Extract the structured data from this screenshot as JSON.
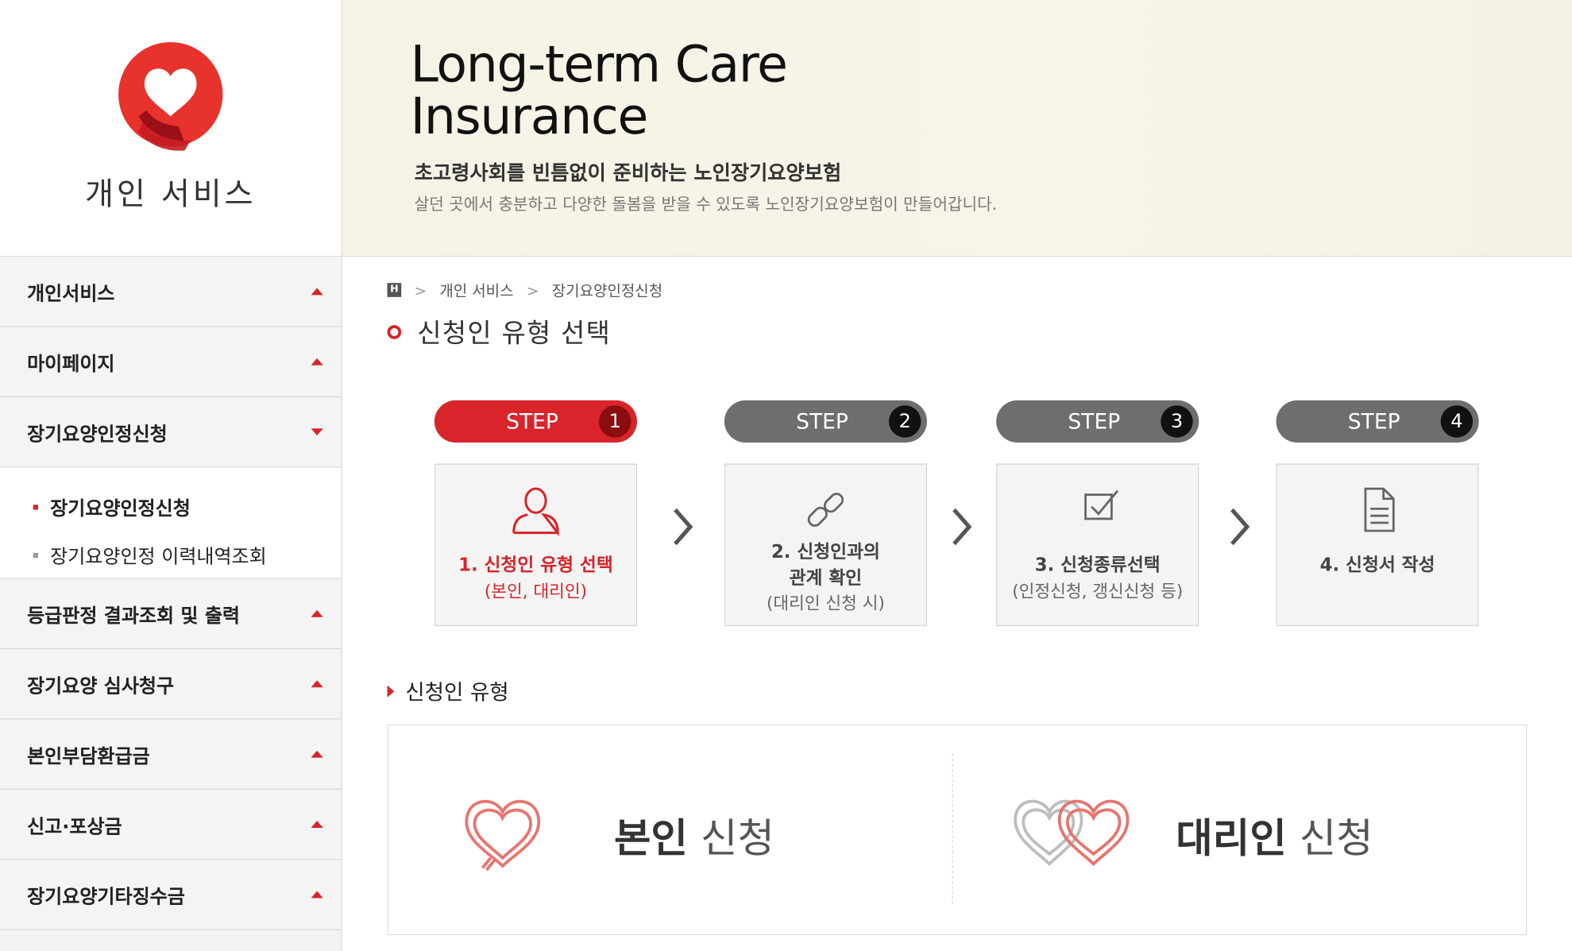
{
  "brand": {
    "section_title": "개인 서비스"
  },
  "sidebar": {
    "items": [
      {
        "label": "개인서비스",
        "state": "collapsed"
      },
      {
        "label": "마이페이지",
        "state": "collapsed"
      },
      {
        "label": "장기요양인정신청",
        "state": "expanded"
      },
      {
        "label": "등급판정 결과조회 및 출력",
        "state": "collapsed"
      },
      {
        "label": "장기요양 심사청구",
        "state": "collapsed"
      },
      {
        "label": "본인부담환급금",
        "state": "collapsed"
      },
      {
        "label": "신고·포상금",
        "state": "collapsed"
      },
      {
        "label": "장기요양기타징수금",
        "state": "collapsed"
      }
    ],
    "subitems": [
      {
        "label": "장기요양인정신청",
        "active": true
      },
      {
        "label": "장기요양인정 이력내역조회",
        "active": false
      }
    ]
  },
  "banner": {
    "title_line1": "Long-term Care",
    "title_line2": "Insurance",
    "subtitle": "초고령사회를 빈틈없이 준비하는 노인장기요양보험",
    "description": "살던 곳에서 충분하고 다양한 돌봄을 받을 수 있도록 노인장기요양보험이 만들어갑니다."
  },
  "breadcrumb": {
    "home": "H",
    "level1": "개인 서비스",
    "level2": "장기요양인정신청"
  },
  "page_title": "신청인 유형 선택",
  "steps": [
    {
      "pill": "STEP",
      "number": "1",
      "title": "1. 신청인 유형 선택",
      "note": "(본인, 대리인)",
      "active": true,
      "icon": "person-icon"
    },
    {
      "pill": "STEP",
      "number": "2",
      "title_l1": "2. 신청인과의",
      "title_l2": "관계 확인",
      "note": "(대리인 신청 시)",
      "active": false,
      "icon": "link-icon"
    },
    {
      "pill": "STEP",
      "number": "3",
      "title": "3. 신청종류선택",
      "note": "(인정신청, 갱신신청 등)",
      "active": false,
      "icon": "checkbox-icon"
    },
    {
      "pill": "STEP",
      "number": "4",
      "title": "4. 신청서 작성",
      "active": false,
      "icon": "document-icon"
    }
  ],
  "section": {
    "title": "신청인 유형"
  },
  "choices": {
    "self": {
      "bold": "본인",
      "rest": " 신청"
    },
    "proxy": {
      "bold": "대리인",
      "rest": " 신청"
    }
  },
  "colors": {
    "accent": "#d8242a",
    "step_inactive": "#6e6e6e",
    "banner_bg": "#f5f3e5"
  }
}
